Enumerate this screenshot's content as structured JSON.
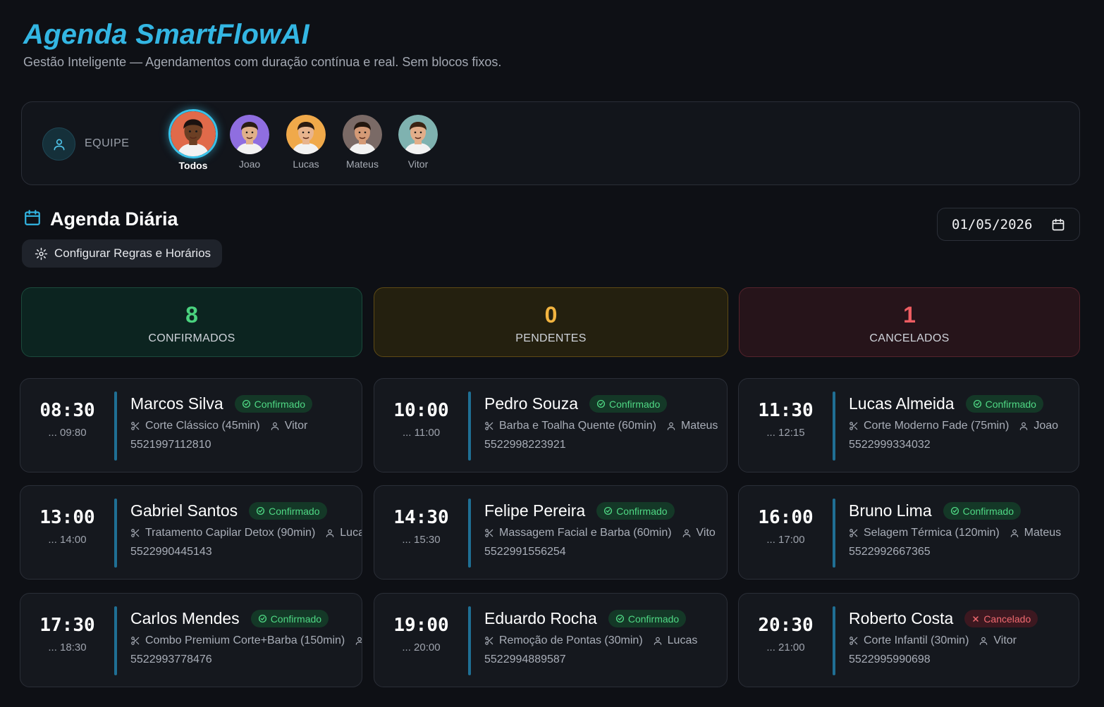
{
  "app": {
    "title": "Agenda SmartFlowAI",
    "subtitle": "Gestão Inteligente — Agendamentos com duração contínua e real. Sem blocos fixos."
  },
  "team": {
    "label": "EQUIPE",
    "members": [
      {
        "name": "Todos",
        "active": true,
        "bg": "#e06a4a",
        "skin": "#6b3f24",
        "hair": "#1b1210"
      },
      {
        "name": "Joao",
        "active": false,
        "bg": "#8f6ee0",
        "skin": "#e0b08a",
        "hair": "#2a1c14"
      },
      {
        "name": "Lucas",
        "active": false,
        "bg": "#f0a94a",
        "skin": "#e8b48d",
        "hair": "#2b1b12"
      },
      {
        "name": "Mateus",
        "active": false,
        "bg": "#7a6a66",
        "skin": "#d49a76",
        "hair": "#23170f"
      },
      {
        "name": "Vitor",
        "active": false,
        "bg": "#7fb2b0",
        "skin": "#e2ae8a",
        "hair": "#3a2414"
      }
    ]
  },
  "section": {
    "title": "Agenda Diária",
    "config_label": "Configurar Regras e Horários",
    "date_value": "01/05/2026"
  },
  "stats": {
    "confirmed": {
      "value": "8",
      "label": "CONFIRMADOS"
    },
    "pending": {
      "value": "0",
      "label": "PENDENTES"
    },
    "cancelled": {
      "value": "1",
      "label": "CANCELADOS"
    }
  },
  "appointments": [
    {
      "start": "08:30",
      "end": "... 09:80",
      "client": "Marcos Silva",
      "status": "Confirmado",
      "service": "Corte Clássico (45min)",
      "barber": "Vitor",
      "phone": "5521997112810"
    },
    {
      "start": "10:00",
      "end": "... 11:00",
      "client": "Pedro Souza",
      "status": "Confirmado",
      "service": "Barba e Toalha Quente (60min)",
      "barber": "Mateus",
      "phone": "5522998223921"
    },
    {
      "start": "11:30",
      "end": "... 12:15",
      "client": "Lucas Almeida",
      "status": "Confirmado",
      "service": "Corte Moderno Fade (75min)",
      "barber": "Joao",
      "phone": "5522999334032"
    },
    {
      "start": "13:00",
      "end": "... 14:00",
      "client": "Gabriel Santos",
      "status": "Confirmado",
      "service": "Tratamento Capilar Detox (90min)",
      "barber": "Luca",
      "phone": "5522990445143"
    },
    {
      "start": "14:30",
      "end": "... 15:30",
      "client": "Felipe Pereira",
      "status": "Confirmado",
      "service": "Massagem Facial e Barba (60min)",
      "barber": "Vito",
      "phone": "5522991556254"
    },
    {
      "start": "16:00",
      "end": "... 17:00",
      "client": "Bruno Lima",
      "status": "Confirmado",
      "service": "Selagem Térmica (120min)",
      "barber": "Mateus",
      "phone": "5522992667365"
    },
    {
      "start": "17:30",
      "end": "... 18:30",
      "client": "Carlos Mendes",
      "status": "Confirmado",
      "service": "Combo Premium Corte+Barba (150min)",
      "barber": "",
      "phone": "5522993778476"
    },
    {
      "start": "19:00",
      "end": "... 20:00",
      "client": "Eduardo Rocha",
      "status": "Confirmado",
      "service": "Remoção de Pontas (30min)",
      "barber": "Lucas",
      "phone": "5522994889587"
    },
    {
      "start": "20:30",
      "end": "... 21:00",
      "client": "Roberto Costa",
      "status": "Cancelado",
      "service": "Corte Infantil (30min)",
      "barber": "Vitor",
      "phone": "5522995990698"
    }
  ],
  "colors": {
    "accent": "#33b6e3",
    "confirmed": "#4ad27e",
    "pending": "#f2b440",
    "cancelled": "#ee5d62"
  }
}
